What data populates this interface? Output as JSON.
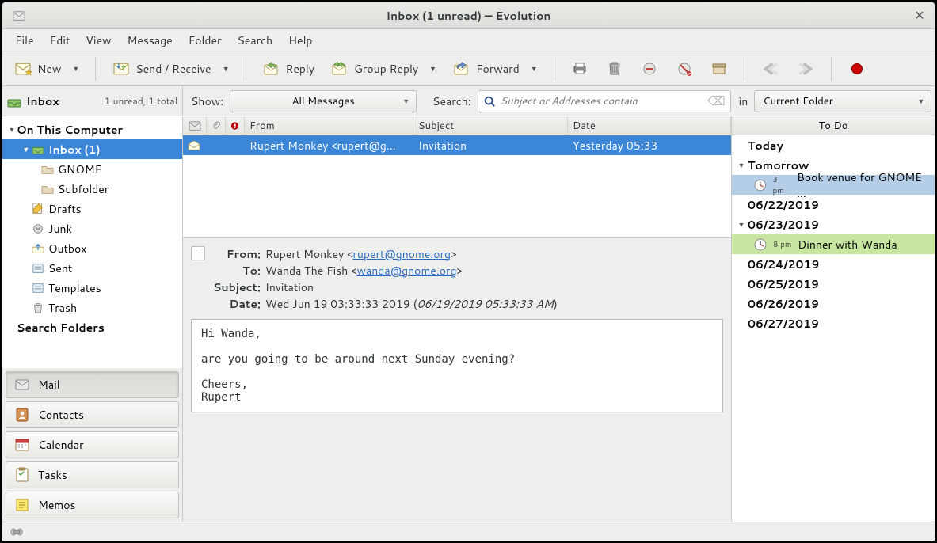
{
  "title": "Inbox (1 unread) — Evolution",
  "menubar": [
    "File",
    "Edit",
    "View",
    "Message",
    "Folder",
    "Search",
    "Help"
  ],
  "toolbar": {
    "new": "New",
    "sendrecv": "Send / Receive",
    "reply": "Reply",
    "groupreply": "Group Reply",
    "forward": "Forward"
  },
  "switcher_head": {
    "title": "Inbox",
    "status": "1 unread, 1 total"
  },
  "filter": {
    "show_label": "Show:",
    "show_value": "All Messages",
    "search_label": "Search:",
    "search_placeholder": "Subject or Addresses contain",
    "in_label": "in",
    "in_value": "Current Folder"
  },
  "tree": {
    "root": "On This Computer",
    "inbox": "Inbox (1)",
    "gnome": "GNOME",
    "subfolder": "Subfolder",
    "drafts": "Drafts",
    "junk": "Junk",
    "outbox": "Outbox",
    "sent": "Sent",
    "templates": "Templates",
    "trash": "Trash",
    "search_folders": "Search Folders"
  },
  "switchers": {
    "mail": "Mail",
    "contacts": "Contacts",
    "calendar": "Calendar",
    "tasks": "Tasks",
    "memos": "Memos"
  },
  "listcols": {
    "from": "From",
    "subject": "Subject",
    "date": "Date"
  },
  "message": {
    "from_col": "Rupert Monkey <rupert@g...",
    "subject_col": "Invitation",
    "date_col": "Yesterday 05:33"
  },
  "hdrlabels": {
    "from": "From:",
    "to": "To:",
    "subject": "Subject:",
    "date": "Date:"
  },
  "hdrvals": {
    "from_name": "Rupert Monkey <",
    "from_email": "rupert@gnome.org",
    "from_close": ">",
    "to_name": "Wanda The Fish <",
    "to_email": "wanda@gnome.org",
    "to_close": ">",
    "subject": "Invitation",
    "date_a": "Wed Jun 19 03:33:33 2019 (",
    "date_b": "06/19/2019 05:33:33 AM",
    "date_c": ")"
  },
  "body": "Hi Wanda,\n\nare you going to be around next Sunday evening?\n\nCheers,\nRupert",
  "todo": {
    "header": "To Do",
    "today": "Today",
    "tomorrow": "Tomorrow",
    "evt1_time": "3 pm",
    "evt1_title": "Book venue for GNOME ...",
    "d0622": "06/22/2019",
    "d0623": "06/23/2019",
    "evt2_time": "8 pm",
    "evt2_title": "Dinner with Wanda",
    "d0624": "06/24/2019",
    "d0625": "06/25/2019",
    "d0626": "06/26/2019",
    "d0627": "06/27/2019"
  }
}
